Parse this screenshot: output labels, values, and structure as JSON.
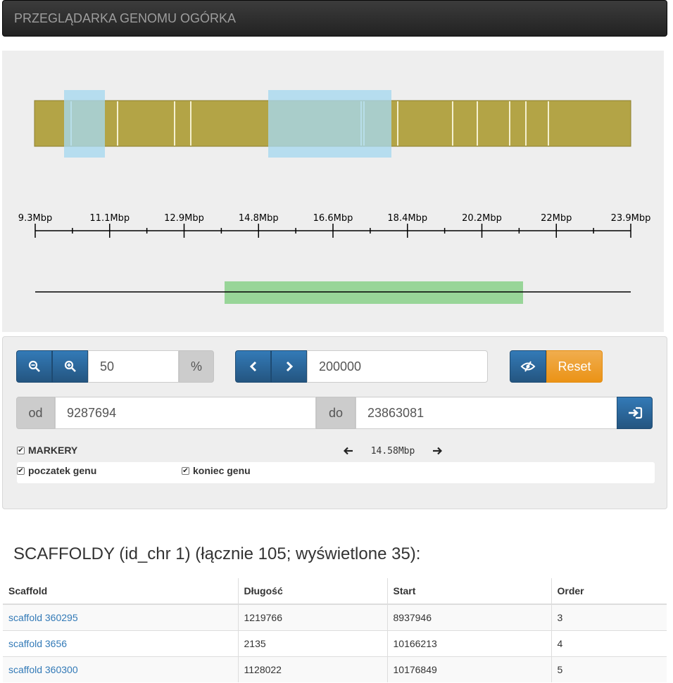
{
  "navbar": {
    "title": "PRZEGLĄDARKA GENOMU OGÓRKA"
  },
  "viewer": {
    "range_start_bp": 9287694,
    "range_end_bp": 23863081,
    "colors": {
      "scaffold": "#b3a446",
      "highlight": "#a7d8f0",
      "selection": "#98d598",
      "axis": "#000000"
    },
    "axis_ticks": [
      "9.3Mbp",
      "11.1Mbp",
      "12.9Mbp",
      "14.8Mbp",
      "16.6Mbp",
      "18.4Mbp",
      "20.2Mbp",
      "22Mbp",
      "23.9Mbp"
    ]
  },
  "controls": {
    "zoom_value": "50",
    "zoom_unit": "%",
    "step_value": "200000",
    "reset_label": "Reset",
    "from_label": "od",
    "from_value": "9287694",
    "to_label": "do",
    "to_value": "23863081",
    "span_label": "14.58Mbp",
    "markers_label": "MARKERY",
    "gene_start_label": "poczatek genu",
    "gene_end_label": "koniec genu"
  },
  "scaffolds": {
    "title": "SCAFFOLDY (id_chr 1) (łącznie 105; wyświetlone 35):",
    "columns": [
      "Scaffold",
      "Długość",
      "Start",
      "Order"
    ],
    "rows": [
      [
        "scaffold 360295",
        "1219766",
        "8937946",
        "3"
      ],
      [
        "scaffold 3656",
        "2135",
        "10166213",
        "4"
      ],
      [
        "scaffold 360300",
        "1128022",
        "10176849",
        "5"
      ]
    ]
  }
}
